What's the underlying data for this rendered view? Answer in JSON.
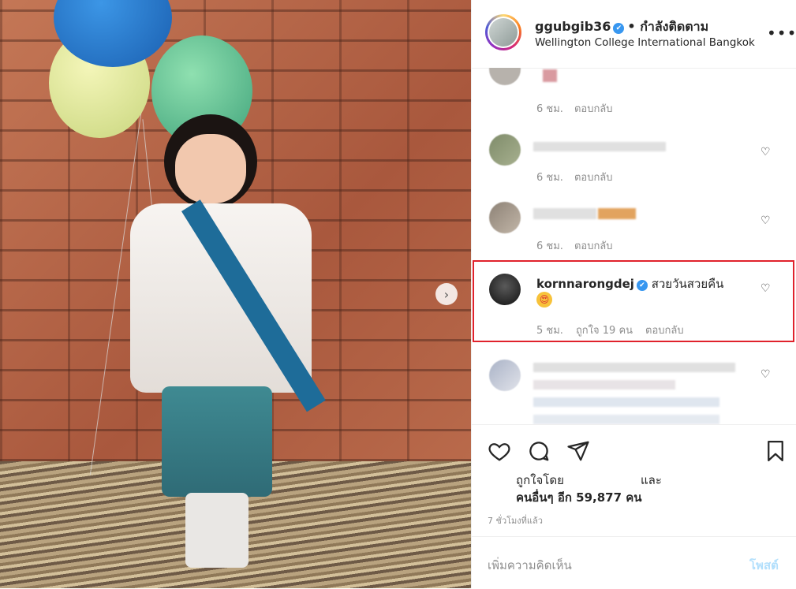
{
  "header": {
    "username": "ggubgib36",
    "verified_mark": "✔",
    "following_label": "• กำลังติดตาม",
    "location": "Wellington College International Bangkok",
    "more_icon": "•••"
  },
  "comments": [
    {
      "time": "6 ชม.",
      "reply": "ตอบกลับ"
    },
    {
      "time": "6 ชม.",
      "reply": "ตอบกลับ"
    },
    {
      "time": "6 ชม.",
      "reply": "ตอบกลับ"
    }
  ],
  "highlighted_comment": {
    "username": "kornnarongdej",
    "text": "สวยวันสวยคืน",
    "emoji": "😍",
    "time": "5 ชม.",
    "likes": "ถูกใจ 19 คน",
    "reply": "ตอบกลับ"
  },
  "likes": {
    "liked_by": "ถูกใจโดย",
    "and": "และ",
    "others": "คนอื่นๆ อีก 59,877 คน"
  },
  "posted_time": "7 ชั่วโมงที่แล้ว",
  "add_comment": {
    "placeholder": "เพิ่มความคิดเห็น",
    "post_label": "โพสต์"
  },
  "colors": {
    "highlight_border": "#e0222c",
    "verified": "#3897f0",
    "post_button_disabled": "#b2dffc"
  }
}
